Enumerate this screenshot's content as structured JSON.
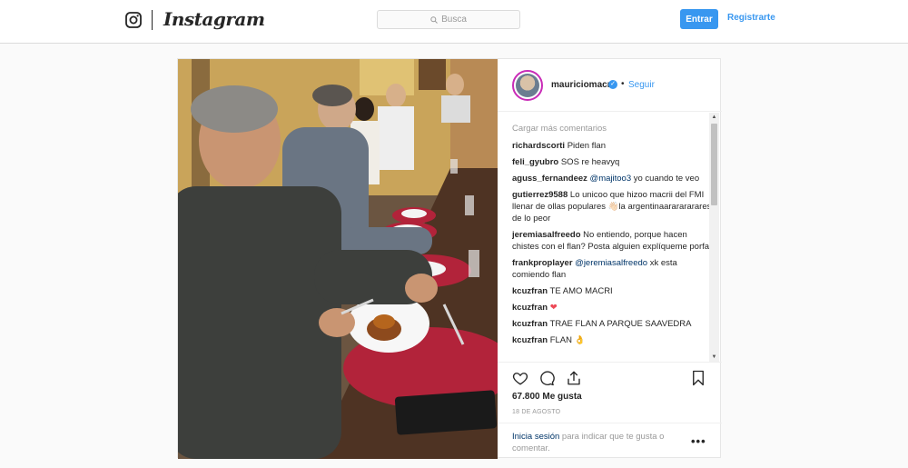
{
  "nav": {
    "logo_text": "Instagram",
    "search_placeholder": "Busca",
    "login_label": "Entrar",
    "register_label": "Registrarte"
  },
  "post": {
    "username": "mauriciomacri",
    "follow_label": "Seguir",
    "load_more": "Cargar más comentarios",
    "comments": [
      {
        "user": "richardscorti",
        "text": "Piden flan"
      },
      {
        "user": "feli_gyubro",
        "text": "SOS re heavyq"
      },
      {
        "user": "aguss_fernandeez",
        "mention": "@majitoo3",
        "text": "yo cuando te veo"
      },
      {
        "user": "gutierrez9588",
        "text": "Lo unicoo que hizoo macrii del FMI llenar de ollas populares 👋🏻la argentinaararararares de lo peor"
      },
      {
        "user": "jeremiasalfreedo",
        "text": "No entiendo, porque hacen chistes con el flan? Posta alguien explíqueme porfa"
      },
      {
        "user": "frankproplayer",
        "mention": "@jeremiasalfreedo",
        "text": "xk esta comiendo flan"
      },
      {
        "user": "kcuzfran",
        "text": "TE AMO MACRI"
      },
      {
        "user": "kcuzfran",
        "text": "❤"
      },
      {
        "user": "kcuzfran",
        "text": "TRAE FLAN A PARQUE SAAVEDRA"
      },
      {
        "user": "kcuzfran",
        "text": "FLAN 👌"
      }
    ],
    "likes": "67.800 Me gusta",
    "date": "18 DE AGOSTO",
    "login_link": "Inicia sesión",
    "login_prompt": "para indicar que te gusta o comentar.",
    "more_label": "•••"
  },
  "icons": {
    "logo": "instagram-camera-icon",
    "search": "search-icon",
    "verified": "verified-badge-icon",
    "like": "heart-icon",
    "comment": "comment-icon",
    "share": "share-icon",
    "save": "bookmark-icon"
  },
  "colors": {
    "accent": "#3897f0",
    "mention": "#003569",
    "muted": "#999999",
    "heart": "#ed4956"
  }
}
